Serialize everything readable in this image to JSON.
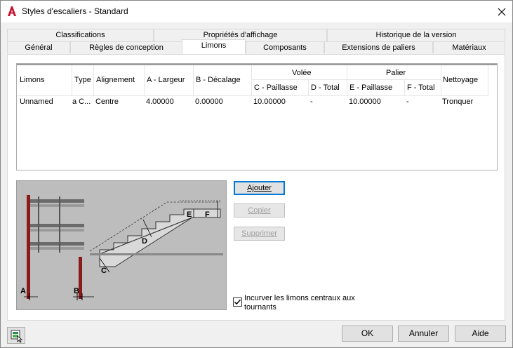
{
  "window": {
    "title": "Styles d'escaliers - Standard"
  },
  "tabs_row1": [
    {
      "label": "Classifications"
    },
    {
      "label": "Propriétés d'affichage"
    },
    {
      "label": "Historique de la version"
    }
  ],
  "tabs_row2": [
    {
      "label": "Général"
    },
    {
      "label": "Règles de conception"
    },
    {
      "label": "Limons",
      "active": true
    },
    {
      "label": "Composants"
    },
    {
      "label": "Extensions de paliers"
    },
    {
      "label": "Matériaux"
    }
  ],
  "grid": {
    "group_headers": {
      "volee": "Volée",
      "palier": "Palier"
    },
    "columns": {
      "limons": "Limons",
      "type": "Type",
      "alignement": "Alignement",
      "a_largeur": "A - Largeur",
      "b_decalage": "B - Décalage",
      "c_paillasse": "C - Paillasse",
      "d_total": "D - Total",
      "e_paillasse": "E - Paillasse",
      "f_total": "F - Total",
      "nettoyage": "Nettoyage"
    },
    "rows": [
      {
        "limons": "Unnamed",
        "type": "a C...",
        "alignement": "Centre",
        "a_largeur": "4.00000",
        "b_decalage": "0.00000",
        "c_paillasse": "10.00000",
        "d_total": "-",
        "e_paillasse": "10.00000",
        "f_total": "-",
        "nettoyage": "Tronquer"
      }
    ]
  },
  "preview": {
    "labels": {
      "a": "A",
      "b": "B",
      "c": "C",
      "d": "D",
      "e": "E",
      "f": "F"
    }
  },
  "actions": {
    "ajouter": "Ajouter",
    "copier": "Copier",
    "supprimer": "Supprimer"
  },
  "options": {
    "incurver_label": "Incurver les limons centraux aux tournants",
    "incurver_checked": true
  },
  "footer": {
    "ok": "OK",
    "annuler": "Annuler",
    "aide": "Aide"
  },
  "colors": {
    "accent": "#0078d7",
    "app_icon": "#c8102e"
  }
}
